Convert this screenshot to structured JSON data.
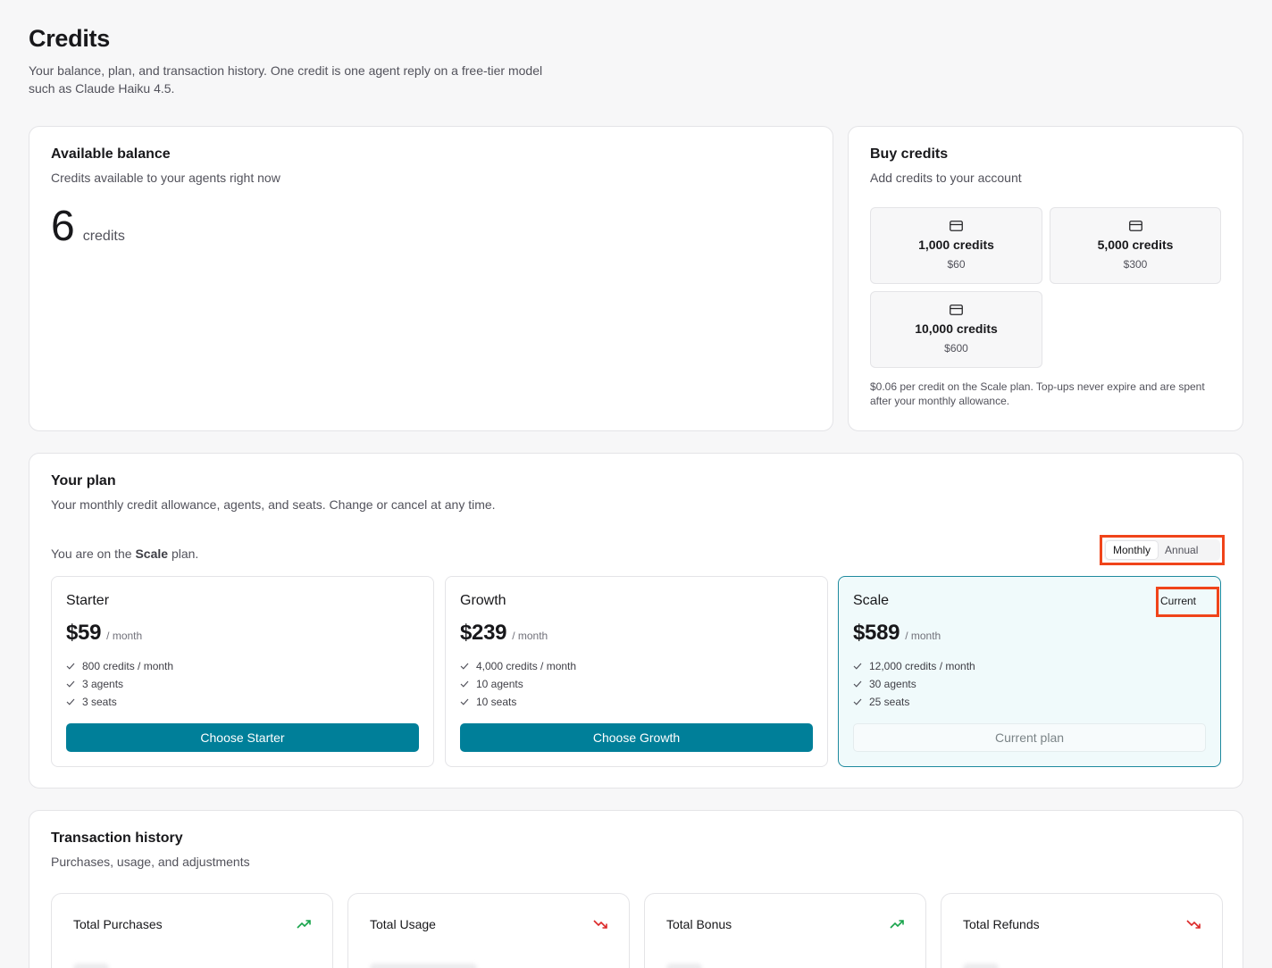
{
  "header": {
    "title": "Credits",
    "subtitle": "Your balance, plan, and transaction history. One credit is one agent reply on a free-tier model such as Claude Haiku 4.5."
  },
  "balance": {
    "title": "Available balance",
    "subtitle": "Credits available to your agents right now",
    "amount": "6",
    "unit": "credits"
  },
  "buy": {
    "title": "Buy credits",
    "subtitle": "Add credits to your account",
    "packs": [
      {
        "credits": "1,000 credits",
        "price": "$60",
        "icon": "credit-card-icon"
      },
      {
        "credits": "5,000 credits",
        "price": "$300",
        "icon": "credit-card-icon"
      },
      {
        "credits": "10,000 credits",
        "price": "$600",
        "icon": "credit-card-icon"
      }
    ],
    "note": "$0.06 per credit on the Scale plan. Top-ups never expire and are spent after your monthly allowance."
  },
  "plan": {
    "title": "Your plan",
    "subtitle": "Your monthly credit allowance, agents, and seats. Change or cancel at any time.",
    "current_prefix": "You are on the",
    "current_name": "Scale",
    "current_suffix": "plan.",
    "billing_options": [
      "Monthly",
      "Annual"
    ],
    "billing_selected": "Monthly",
    "current_badge": "Current",
    "tiers": [
      {
        "name": "Starter",
        "price": "$59",
        "period": "/ month",
        "features": [
          "800 credits / month",
          "3 agents",
          "3 seats"
        ],
        "button": "Choose Starter",
        "current": false
      },
      {
        "name": "Growth",
        "price": "$239",
        "period": "/ month",
        "features": [
          "4,000 credits / month",
          "10 agents",
          "10 seats"
        ],
        "button": "Choose Growth",
        "current": false
      },
      {
        "name": "Scale",
        "price": "$589",
        "period": "/ month",
        "features": [
          "12,000 credits / month",
          "30 agents",
          "25 seats"
        ],
        "button": "Current plan",
        "current": true
      }
    ]
  },
  "transactions": {
    "title": "Transaction history",
    "subtitle": "Purchases, usage, and adjustments",
    "stats": [
      {
        "label": "Total Purchases",
        "trend": "trending-up-icon",
        "color": "#16a34a"
      },
      {
        "label": "Total Usage",
        "trend": "trending-down-icon",
        "color": "#dc2626"
      },
      {
        "label": "Total Bonus",
        "trend": "trending-up-icon",
        "color": "#16a34a"
      },
      {
        "label": "Total Refunds",
        "trend": "trending-down-icon",
        "color": "#dc2626"
      }
    ]
  },
  "colors": {
    "accent": "#007f99",
    "highlight": "#f0441a"
  }
}
